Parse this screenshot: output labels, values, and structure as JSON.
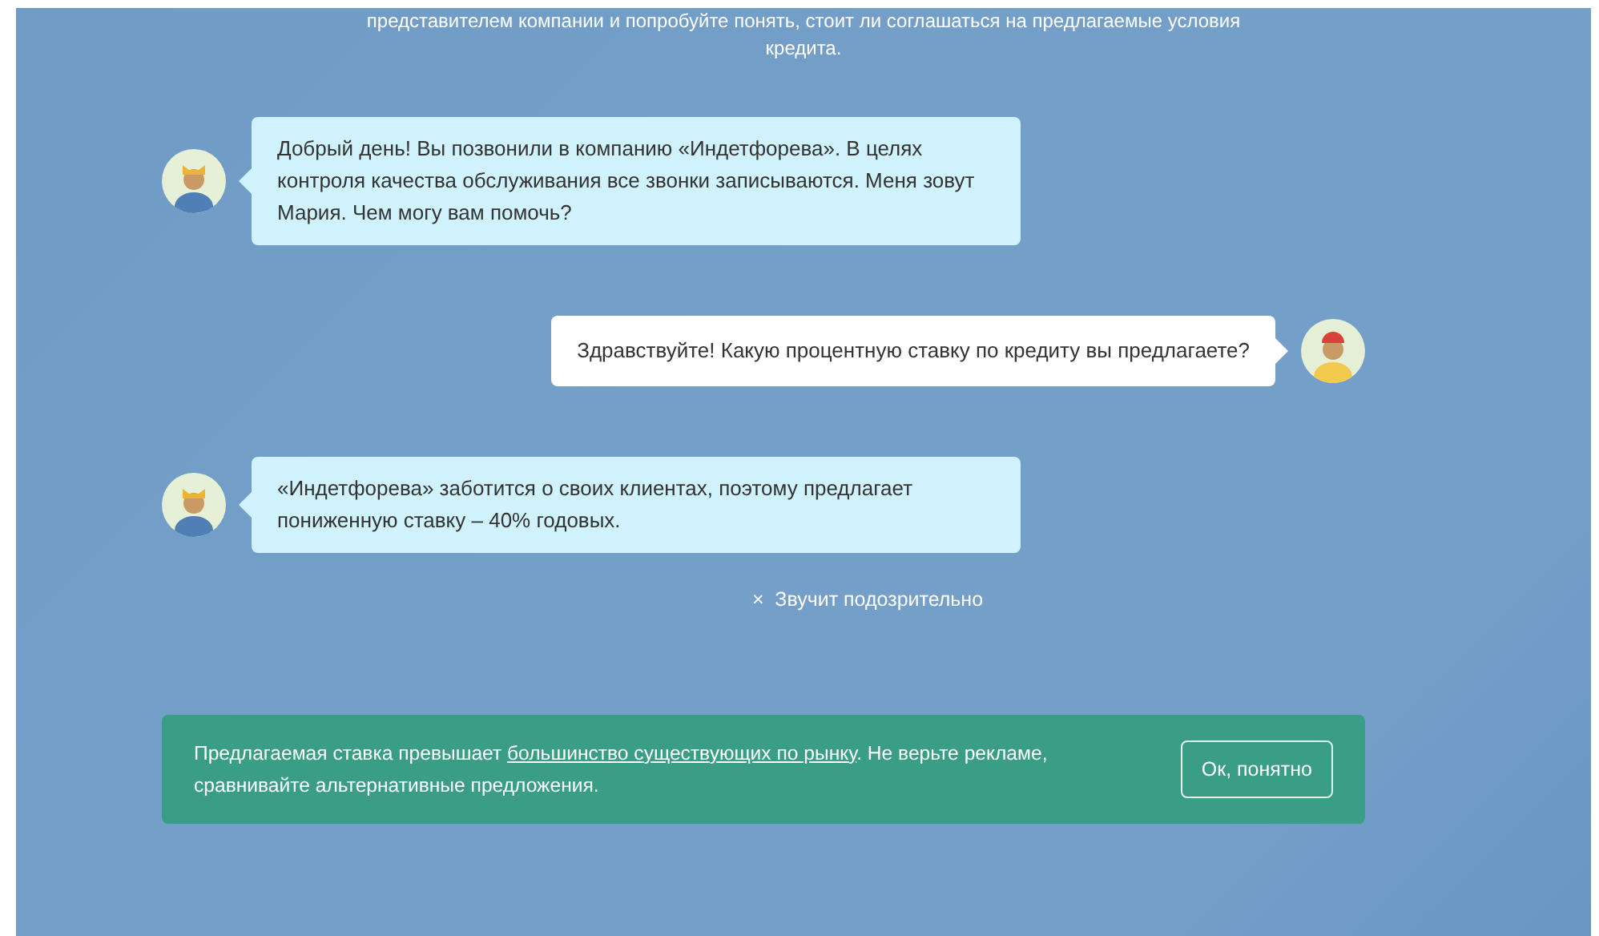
{
  "intro": {
    "lines": [
      "представителем компании и попробуйте понять, стоит ли соглашаться на предлагаемые условия",
      "кредита."
    ]
  },
  "messages": [
    {
      "kind": "operator",
      "text": "Добрый день! Вы позвонили в компанию «Индетфорева». В целях контроля качества обслуживания все звонки записываются. Меня зовут Мария. Чем могу вам помочь?"
    },
    {
      "kind": "user",
      "text": "Здравствуйте! Какую процентную ставку по кредиту вы предлагаете?"
    },
    {
      "kind": "operator",
      "text": "«Индетфорева» заботится о своих клиентах, поэтому предлагает пониженную ставку – 40% годовых."
    }
  ],
  "reply_option": {
    "icon": "×",
    "label": "Звучит подозрительно"
  },
  "alert": {
    "text_before": "Предлагаемая ставка превышает ",
    "link": "большинство существующих по рынку",
    "text_after": ". Не верьте рекламе, сравнивайте альтернативные предложения.",
    "button": "Ок, понятно"
  }
}
